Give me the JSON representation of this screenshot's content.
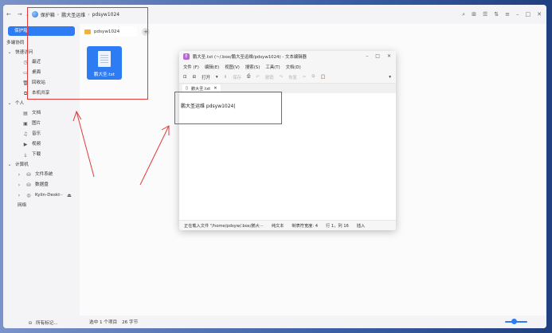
{
  "file_manager": {
    "breadcrumb": [
      "保护箱",
      "鹏大圣运维",
      "pdsyw1024"
    ],
    "sidebar": {
      "active_item": "保护箱",
      "multi_device": "多端协同",
      "quick_access": {
        "label": "快速访问",
        "items": [
          {
            "label": "最近",
            "icon": "clock-icon"
          },
          {
            "label": "桌面",
            "icon": "desktop-icon"
          },
          {
            "label": "回收站",
            "icon": "trash-icon"
          },
          {
            "label": "本机共享",
            "icon": "share-icon"
          }
        ]
      },
      "personal": {
        "label": "个人",
        "items": [
          {
            "label": "文档",
            "icon": "document-icon"
          },
          {
            "label": "图片",
            "icon": "image-icon"
          },
          {
            "label": "音乐",
            "icon": "music-icon"
          },
          {
            "label": "视频",
            "icon": "video-icon"
          },
          {
            "label": "下载",
            "icon": "download-icon"
          }
        ]
      },
      "computer": {
        "label": "计算机",
        "items": [
          {
            "label": "文件系统",
            "icon": "drive-icon"
          },
          {
            "label": "数据盘",
            "icon": "drive-icon"
          },
          {
            "label": "Kylin-Deskt··",
            "icon": "disc-icon"
          }
        ]
      },
      "network": "网络",
      "all_tags": "所有标记..."
    },
    "tab_label": "pdsyw1024",
    "file_name": "鹏大圣.txt",
    "status": {
      "selected": "选中 1 个项目",
      "size": "26 字节"
    }
  },
  "editor": {
    "title": "鹏大圣.txt (~/.box/鹏大圣运维/pdsyw1024) - 文本编辑器",
    "menu": [
      "文件 (F)",
      "编辑(E)",
      "视图(V)",
      "搜索(S)",
      "工具(T)",
      "文档(D)"
    ],
    "toolbar": {
      "open": "打开",
      "save": "保存",
      "undo": "撤销",
      "redo": "恢复"
    },
    "tab_name": "鹏大圣.txt",
    "content": "鹏大圣运维 pdsyw1024",
    "status": {
      "loading": "正在载入文件 \"/home/pdsyw/.box/鹏大···",
      "mode": "纯文本",
      "tab_width": "制表符宽度: 4",
      "position": "行 1，列 16",
      "insert": "插入"
    }
  },
  "colors": {
    "accent": "#2d7cf4",
    "annotation": "#e23a3a"
  }
}
